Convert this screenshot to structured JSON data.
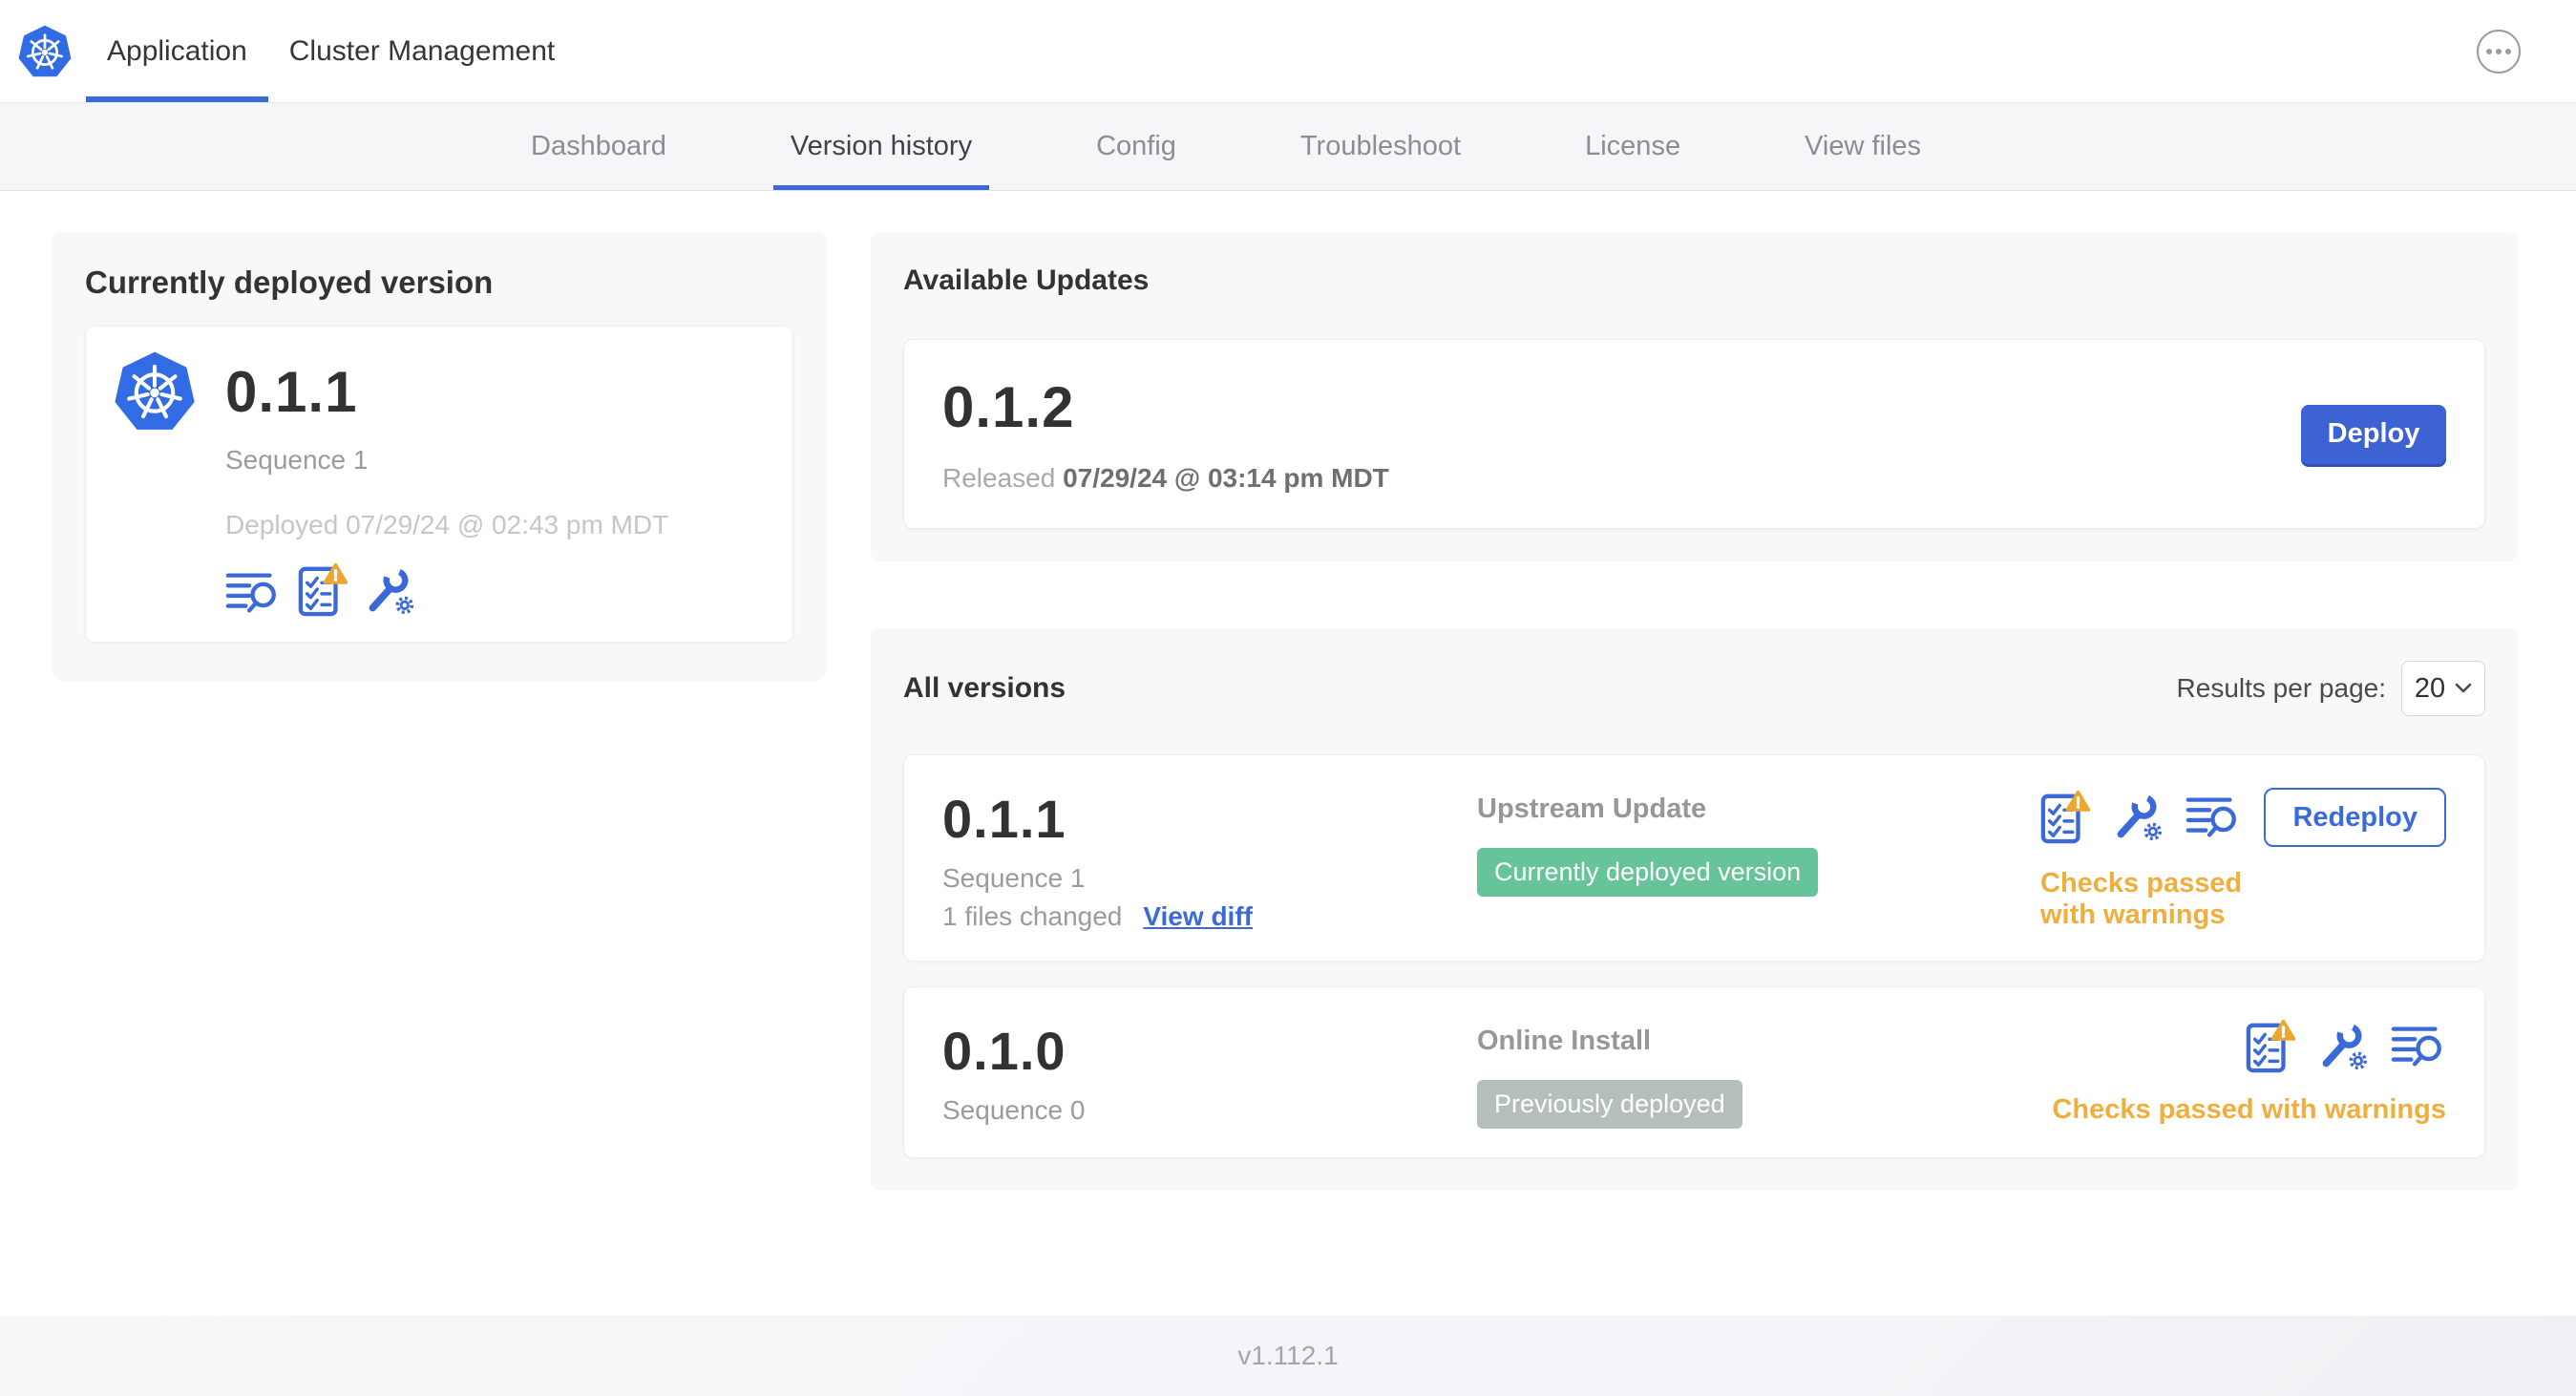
{
  "header": {
    "tabs": [
      {
        "label": "Application",
        "active": true
      },
      {
        "label": "Cluster Management",
        "active": false
      }
    ]
  },
  "subnav": {
    "items": [
      "Dashboard",
      "Version history",
      "Config",
      "Troubleshoot",
      "License",
      "View files"
    ],
    "active": "Version history"
  },
  "deployed_card": {
    "title": "Currently deployed version",
    "version": "0.1.1",
    "sequence": "Sequence 1",
    "deployed_at": "Deployed 07/29/24 @ 02:43 pm MDT"
  },
  "available_updates": {
    "title": "Available Updates",
    "version": "0.1.2",
    "released_label": "Released",
    "released_date": "07/29/24 @ 03:14 pm MDT",
    "deploy_label": "Deploy"
  },
  "all_versions": {
    "title": "All versions",
    "results_per_page_label": "Results per page:",
    "results_per_page_value": "20",
    "rows": [
      {
        "version": "0.1.1",
        "sequence": "Sequence 1",
        "files_changed": "1 files changed",
        "view_diff_label": "View diff",
        "source": "Upstream Update",
        "badge": "Currently deployed version",
        "badge_color": "#67c39a",
        "status": "Checks passed with warnings",
        "action_label": "Redeploy"
      },
      {
        "version": "0.1.0",
        "sequence": "Sequence 0",
        "source": "Online Install",
        "badge": "Previously deployed",
        "badge_color": "#b4bfbc",
        "status": "Checks passed with warnings"
      }
    ]
  },
  "footer": {
    "version": "v1.112.1"
  },
  "icons": {
    "logo": "kubernetes-logo",
    "more": "more-options-icon",
    "logs": "view-logs-icon",
    "preflight": "preflight-checks-icon",
    "config": "edit-config-icon",
    "warning": "warning-triangle-icon",
    "chevron": "chevron-down-icon"
  },
  "colors": {
    "accent": "#3c69d8",
    "deploy_button": "#3d62d4",
    "success_badge": "#67c39a",
    "muted_badge": "#b4bfbc",
    "warning_text": "#efae3e",
    "warning_triangle": "#eca733"
  }
}
